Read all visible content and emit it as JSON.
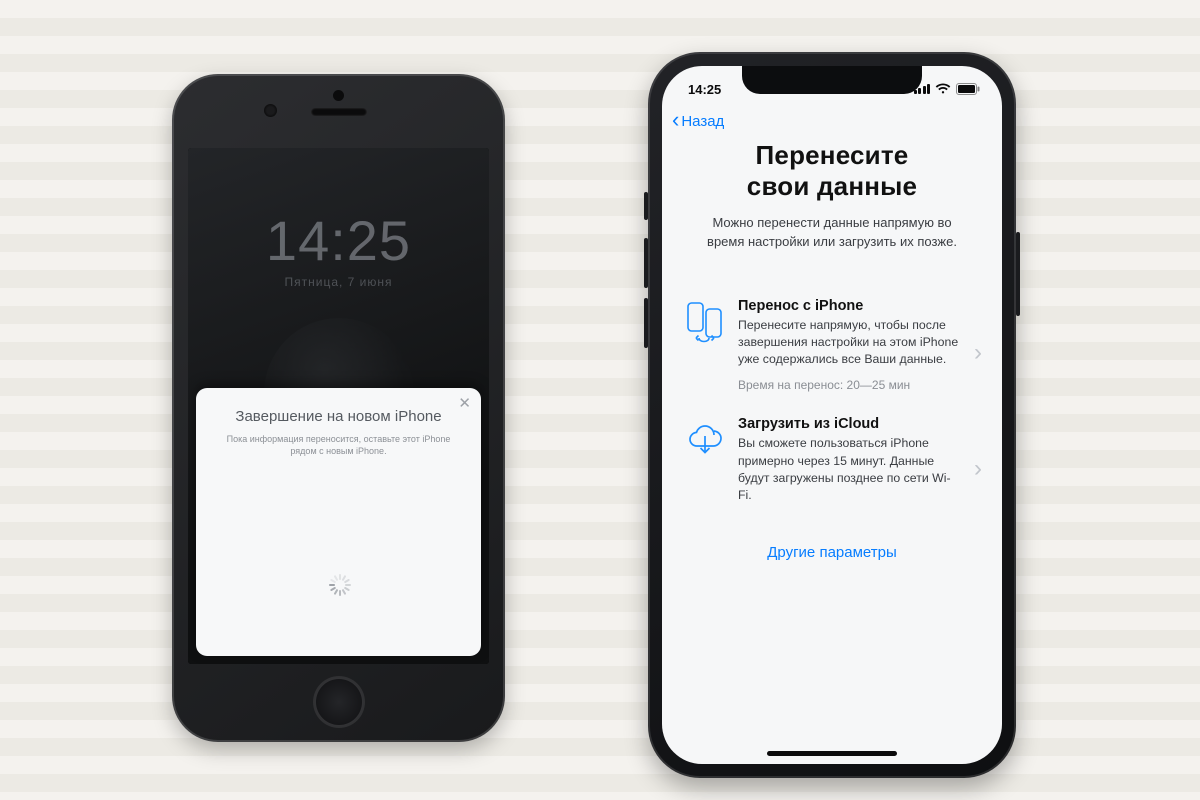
{
  "old_phone": {
    "clock_time": "14:25",
    "clock_date": "Пятница, 7 июня",
    "modal": {
      "title": "Завершение на новом iPhone",
      "body": "Пока информация переносится, оставьте этот iPhone рядом с новым iPhone."
    }
  },
  "new_phone": {
    "status": {
      "time": "14:25"
    },
    "nav": {
      "back": "Назад"
    },
    "page": {
      "title_line1": "Перенесите",
      "title_line2": "свои данные",
      "subtitle": "Можно перенести данные напрямую во время настройки или загрузить их позже."
    },
    "options": [
      {
        "title": "Перенос с iPhone",
        "desc": "Перенесите напрямую, чтобы после завершения настройки на этом iPhone уже содержались все Ваши данные.",
        "meta": "Время на перенос: 20—25 мин"
      },
      {
        "title": "Загрузить из iCloud",
        "desc": "Вы сможете пользоваться iPhone примерно через 15 минут. Данные будут загружены позднее по сети Wi-Fi."
      }
    ],
    "other_params": "Другие параметры"
  }
}
